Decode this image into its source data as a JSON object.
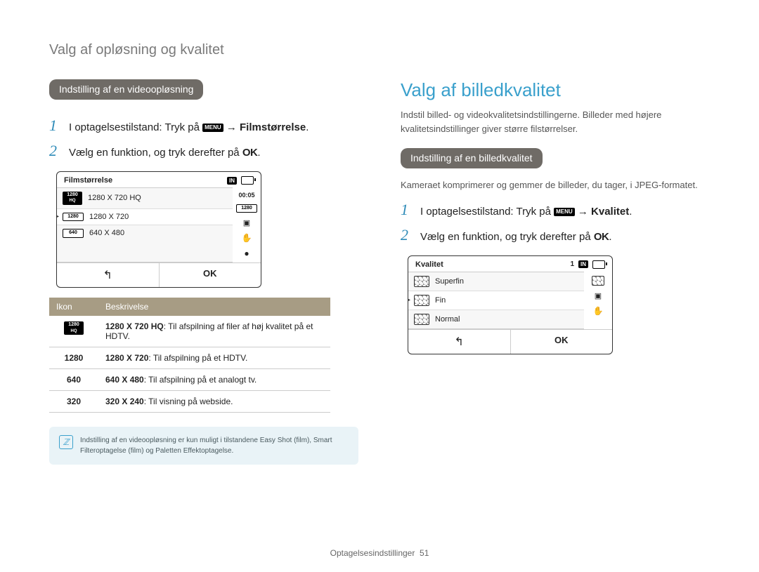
{
  "breadcrumb": "Valg af opløsning og kvalitet",
  "left": {
    "pill": "Indstilling af en videoopløsning",
    "step1_a": "I optagelsestilstand: Tryk på ",
    "step1_b": " → ",
    "step1_bold": "Filmstørrelse",
    "step1_c": ".",
    "step2_a": "Vælg en funktion, og tryk derefter på ",
    "step2_ok": "OK",
    "step2_b": ".",
    "lcd": {
      "title": "Filmstørrelse",
      "time": "00:05",
      "right_tag": "1280",
      "in": "IN",
      "rows": [
        {
          "tag": "1280",
          "sub": "HQ",
          "label": "1280 X 720 HQ"
        },
        {
          "tag": "1280",
          "label": "1280 X 720"
        },
        {
          "tag": "640",
          "label": "640 X 480"
        }
      ],
      "back": "↰",
      "ok": "OK"
    },
    "table": {
      "h1": "Ikon",
      "h2": "Beskrivelse",
      "rows": [
        {
          "icon": "1280",
          "sub": "HQ",
          "bold": "1280 X 720 HQ",
          "rest": ": Til afspilning af filer af høj kvalitet på et HDTV."
        },
        {
          "icon": "1280",
          "bold": "1280 X 720",
          "rest": ": Til afspilning på et HDTV."
        },
        {
          "icon": "640",
          "bold": "640 X 480",
          "rest": ": Til afspilning på et analogt tv."
        },
        {
          "icon": "320",
          "bold": "320 X 240",
          "rest": ": Til visning på webside."
        }
      ]
    },
    "note": "Indstilling af en videoopløsning er kun muligt i tilstandene Easy Shot (film), Smart Filteroptagelse (film) og Paletten Effektoptagelse."
  },
  "right": {
    "title": "Valg af billedkvalitet",
    "intro": "Indstil billed- og videokvalitetsindstillingerne. Billeder med højere kvalitetsindstillinger giver større filstørrelser.",
    "pill": "Indstilling af en billedkvalitet",
    "sub": "Kameraet komprimerer og gemmer de billeder, du tager, i JPEG-formatet.",
    "step1_a": "I optagelsestilstand: Tryk på ",
    "step1_b": " → ",
    "step1_bold": "Kvalitet",
    "step1_c": ".",
    "step2_a": "Vælg en funktion, og tryk derefter på ",
    "step2_ok": "OK",
    "step2_b": ".",
    "lcd": {
      "title": "Kvalitet",
      "count": "1",
      "in": "IN",
      "rows": [
        {
          "label": "Superfin"
        },
        {
          "label": "Fin"
        },
        {
          "label": "Normal"
        }
      ],
      "back": "↰",
      "ok": "OK"
    }
  },
  "footer_a": "Optagelsesindstillinger",
  "footer_b": "51",
  "menu_label": "MENU"
}
